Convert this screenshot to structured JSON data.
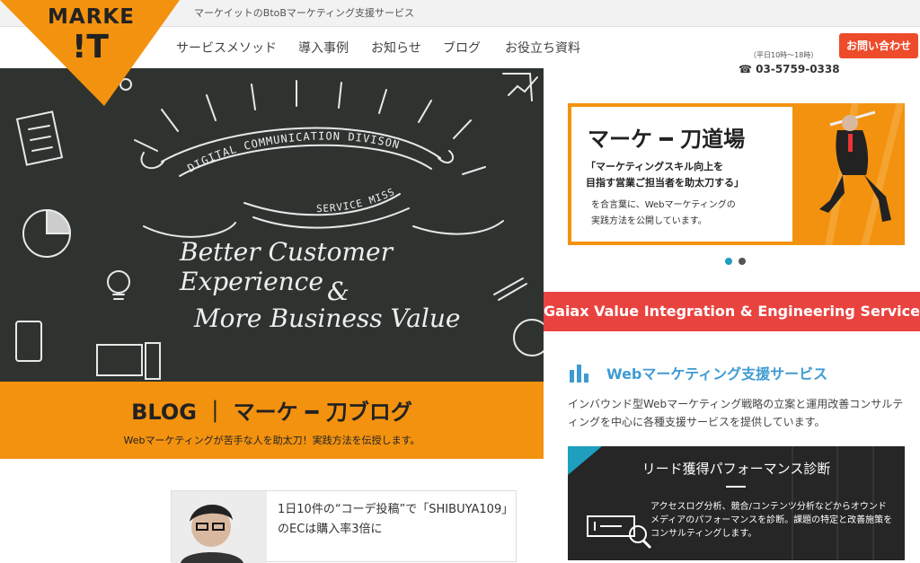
{
  "header": {
    "tagline": "マーケイットのBtoBマーケティング支援サービス",
    "logo_line1": "MARKE",
    "logo_line2": "!T",
    "nav": [
      "サービスメソッド",
      "導入事例",
      "お知らせ",
      "ブログ",
      "お役立ち資料"
    ],
    "phone": "03-5759-0338",
    "phone_hours": "（平日10時〜18時）",
    "contact_button": "お問い合わせ"
  },
  "hero": {
    "arc_top": "DIGITAL COMMUNICATION DIVISON",
    "arc_bottom": "SERVICE MISSION",
    "line1": "Better Customer Experience",
    "amp": "&",
    "line2": "More Business Value"
  },
  "blog": {
    "title": "BLOG ｜ マーケ ━ 刀ブログ",
    "subtitle": "Webマーケティングが苦手な人を助太刀！実践方法を伝授します。"
  },
  "article": {
    "title": "1日10件の“コーデ投稿”で「SHIBUYA109」のECは購入率3倍に"
  },
  "sidebar": {
    "banner": {
      "title": "マーケ ━ 刀道場",
      "lead1": "「マーケティングスキル向上を",
      "lead2": "目指す営業ご担当者を助太刀する」",
      "text1": "を合言葉に、Webマーケティングの",
      "text2": "実践方法を公開しています。"
    },
    "carousel_active": 1,
    "carousel_count": 2,
    "gaiax_heading": "Gaiax Value Integration & Engineering Service",
    "web_service_title": "Webマーケティング支援サービス",
    "web_service_desc": "インバウンド型Webマーケティング戦略の立案と運用改善コンサルティングを中心に各種支援サービスを提供しています。",
    "diagnosis_title": "リード獲得パフォーマンス診断",
    "diagnosis_text": "アクセスログ分析、競合/コンテンツ分析などからオウンドメディアのパフォーマンスを診断。課題の特定と改善施策をコンサルティングします。"
  },
  "colors": {
    "brand_orange": "#f3920f",
    "red": "#e94340",
    "blue": "#3f9bd1",
    "chalkboard": "#2f3330"
  }
}
